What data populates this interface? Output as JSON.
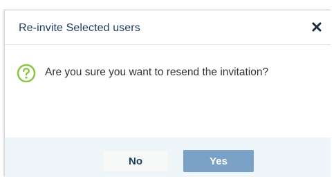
{
  "dialog": {
    "title": "Re-invite Selected users",
    "close_icon": "close-icon",
    "question_icon": "question-circle-icon",
    "message": "Are you sure you want to resend the invitation?",
    "buttons": {
      "no_label": "No",
      "yes_label": "Yes"
    }
  },
  "colors": {
    "title_text": "#1b3c5c",
    "icon_green": "#8cc63f",
    "footer_bg": "#eef6fa",
    "yes_button_bg": "#7aa2c6",
    "no_button_bg": "#f7f8f8"
  }
}
